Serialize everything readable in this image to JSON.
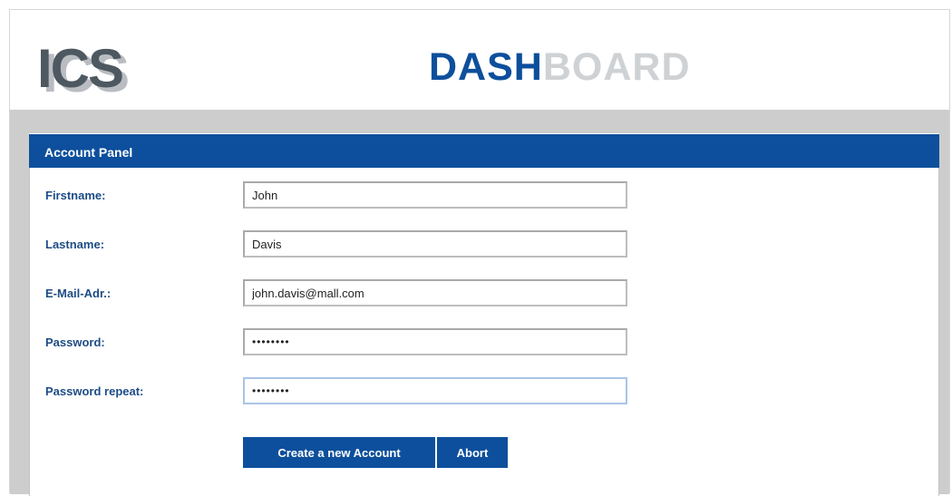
{
  "header": {
    "logo_text": "ICS",
    "title_dark": "DASH",
    "title_light": "BOARD"
  },
  "panel": {
    "title": "Account Panel",
    "fields": [
      {
        "label": "Firstname:",
        "value": "John"
      },
      {
        "label": "Lastname:",
        "value": "Davis"
      },
      {
        "label": "E-Mail-Adr.:",
        "value": "john.davis@mall.com"
      },
      {
        "label": "Password:",
        "value": "••••••••"
      },
      {
        "label": "Password repeat:",
        "value": "••••••••"
      }
    ],
    "buttons": {
      "create_label": "Create a new Account",
      "abort_label": "Abort"
    }
  },
  "colors": {
    "accent": "#0d4f9c",
    "label_text": "#1d4c86",
    "background_grey": "#cdcdcd"
  }
}
